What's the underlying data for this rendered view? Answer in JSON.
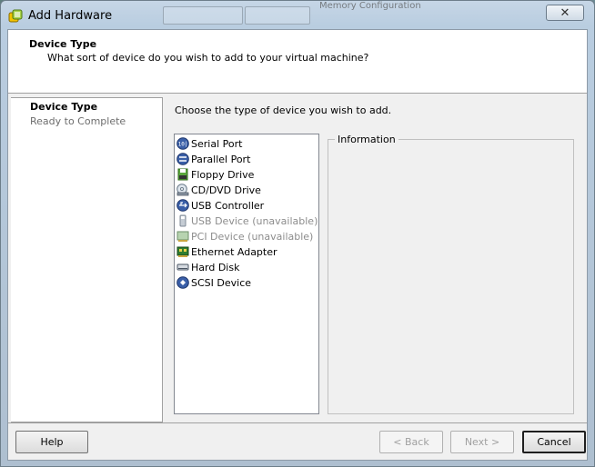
{
  "window": {
    "title": "Add Hardware",
    "close_label": "✕"
  },
  "background_text": "Memory Configuration",
  "header": {
    "title": "Device Type",
    "subtitle": "What sort of device do you wish to add to your virtual machine?"
  },
  "nav": {
    "items": [
      {
        "label": "Device Type"
      },
      {
        "label": "Ready to Complete"
      }
    ]
  },
  "main": {
    "prompt": "Choose the type of device you wish to add.",
    "devices": [
      {
        "label": "Serial Port",
        "icon": "serial-port-icon"
      },
      {
        "label": "Parallel Port",
        "icon": "parallel-port-icon"
      },
      {
        "label": "Floppy Drive",
        "icon": "floppy-drive-icon"
      },
      {
        "label": "CD/DVD Drive",
        "icon": "cd-dvd-drive-icon"
      },
      {
        "label": "USB Controller",
        "icon": "usb-controller-icon"
      },
      {
        "label": "USB Device (unavailable)",
        "icon": "usb-device-icon"
      },
      {
        "label": "PCI Device (unavailable)",
        "icon": "pci-device-icon"
      },
      {
        "label": "Ethernet Adapter",
        "icon": "ethernet-adapter-icon"
      },
      {
        "label": "Hard Disk",
        "icon": "hard-disk-icon"
      },
      {
        "label": "SCSI Device",
        "icon": "scsi-device-icon"
      }
    ],
    "info_legend": "Information"
  },
  "buttons": {
    "help": "Help",
    "back": "< Back",
    "next": "Next >",
    "cancel": "Cancel"
  },
  "colors": {
    "window_frame": "#b9cde0",
    "client_bg": "#f0f0f0",
    "disabled_text": "#8c8c8c"
  }
}
